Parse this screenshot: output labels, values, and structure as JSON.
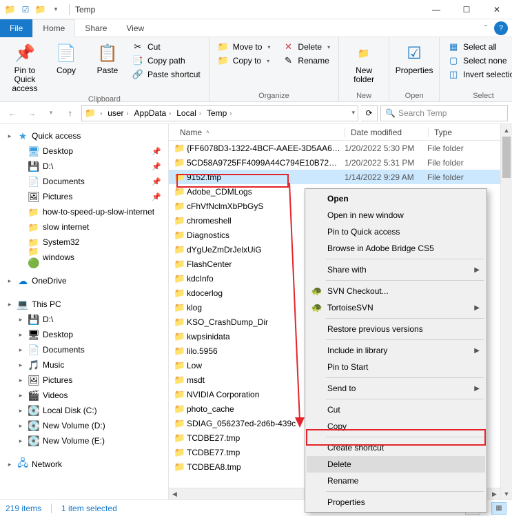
{
  "titlebar": {
    "title": "Temp"
  },
  "window_controls": {
    "min": "—",
    "max": "☐",
    "close": "✕"
  },
  "tabs": {
    "file": "File",
    "home": "Home",
    "share": "Share",
    "view": "View"
  },
  "ribbon": {
    "clipboard": {
      "label": "Clipboard",
      "pin": "Pin to Quick access",
      "copy": "Copy",
      "paste": "Paste",
      "cut": "Cut",
      "copypath": "Copy path",
      "pasteshort": "Paste shortcut"
    },
    "organize": {
      "label": "Organize",
      "moveto": "Move to",
      "copyto": "Copy to",
      "delete": "Delete",
      "rename": "Rename"
    },
    "new": {
      "label": "New",
      "newfolder": "New folder"
    },
    "open": {
      "label": "Open",
      "properties": "Properties"
    },
    "select": {
      "label": "Select",
      "all": "Select all",
      "none": "Select none",
      "invert": "Invert selection"
    }
  },
  "breadcrumb": [
    "user",
    "AppData",
    "Local",
    "Temp"
  ],
  "search": {
    "placeholder": "Search Temp"
  },
  "columns": {
    "name": "Name",
    "date": "Date modified",
    "type": "Type"
  },
  "nav": {
    "quick": "Quick access",
    "items1": [
      "Desktop",
      "D:\\",
      "Documents",
      "Pictures",
      "how-to-speed-up-slow-internet",
      "slow internet",
      "System32",
      "windows"
    ],
    "onedrive": "OneDrive",
    "thispc": "This PC",
    "items2": [
      "D:\\",
      "Desktop",
      "Documents",
      "Music",
      "Pictures",
      "Videos",
      "Local Disk (C:)",
      "New Volume (D:)",
      "New Volume (E:)"
    ],
    "network": "Network"
  },
  "files": [
    {
      "name": "{FF6078D3-1322-4BCF-AAEE-3D5AA6745...",
      "date": "1/20/2022 5:30 PM",
      "type": "File folder"
    },
    {
      "name": "5CD58A9725FF4099A44C794E10B72C57",
      "date": "1/20/2022 5:31 PM",
      "type": "File folder"
    },
    {
      "name": "9152.tmp",
      "date": "1/14/2022 9:29 AM",
      "type": "File folder",
      "selected": true
    },
    {
      "name": "Adobe_CDMLogs",
      "date": "",
      "type": ""
    },
    {
      "name": "cFhVfNclmXbPbGyS",
      "date": "",
      "type": ""
    },
    {
      "name": "chromeshell",
      "date": "",
      "type": ""
    },
    {
      "name": "Diagnostics",
      "date": "",
      "type": ""
    },
    {
      "name": "dYgUeZmDrJelxUiG",
      "date": "",
      "type": ""
    },
    {
      "name": "FlashCenter",
      "date": "",
      "type": ""
    },
    {
      "name": "kdcInfo",
      "date": "",
      "type": ""
    },
    {
      "name": "kdocerlog",
      "date": "",
      "type": ""
    },
    {
      "name": "klog",
      "date": "",
      "type": ""
    },
    {
      "name": "KSO_CrashDump_Dir",
      "date": "",
      "type": ""
    },
    {
      "name": "kwpsinidata",
      "date": "",
      "type": ""
    },
    {
      "name": "lilo.5956",
      "date": "",
      "type": ""
    },
    {
      "name": "Low",
      "date": "",
      "type": ""
    },
    {
      "name": "msdt",
      "date": "",
      "type": ""
    },
    {
      "name": "NVIDIA Corporation",
      "date": "",
      "type": ""
    },
    {
      "name": "photo_cache",
      "date": "",
      "type": ""
    },
    {
      "name": "SDIAG_056237ed-2d6b-439c",
      "date": "",
      "type": ""
    },
    {
      "name": "TCDBE27.tmp",
      "date": "",
      "type": ""
    },
    {
      "name": "TCDBE77.tmp",
      "date": "",
      "type": ""
    },
    {
      "name": "TCDBEA8.tmp",
      "date": "",
      "type": ""
    }
  ],
  "context": {
    "open": "Open",
    "opennew": "Open in new window",
    "pinquick": "Pin to Quick access",
    "bridge": "Browse in Adobe Bridge CS5",
    "sharewith": "Share with",
    "svn": "SVN Checkout...",
    "tortoise": "TortoiseSVN",
    "restore": "Restore previous versions",
    "library": "Include in library",
    "pinstart": "Pin to Start",
    "sendto": "Send to",
    "cut": "Cut",
    "copy": "Copy",
    "createshort": "Create shortcut",
    "delete": "Delete",
    "rename": "Rename",
    "properties": "Properties"
  },
  "status": {
    "items": "219 items",
    "selected": "1 item selected"
  }
}
